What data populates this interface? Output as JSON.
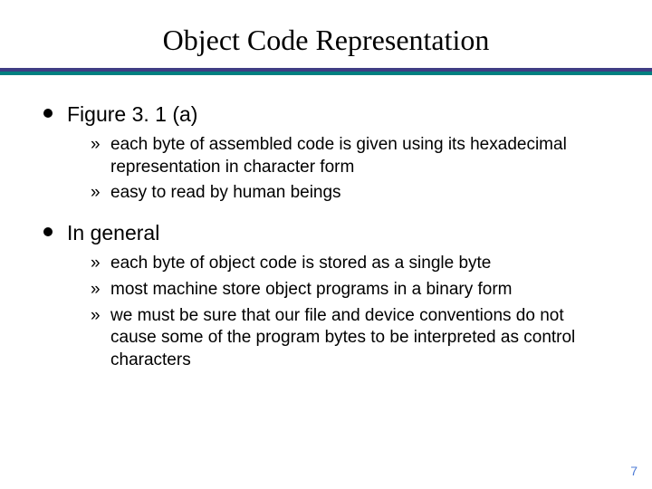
{
  "title": "Object Code Representation",
  "bullets": [
    {
      "label": "Figure 3. 1 (a)",
      "sub": [
        "each byte of assembled code is given using its hexadecimal representation in character form",
        "easy to read by human beings"
      ]
    },
    {
      "label": "In general",
      "sub": [
        "each byte of object code is stored as a single byte",
        "most machine store object programs in a binary form",
        "we must be sure that our file and device conventions do not cause some of the program bytes to be interpreted as control characters"
      ]
    }
  ],
  "page_number": "7"
}
